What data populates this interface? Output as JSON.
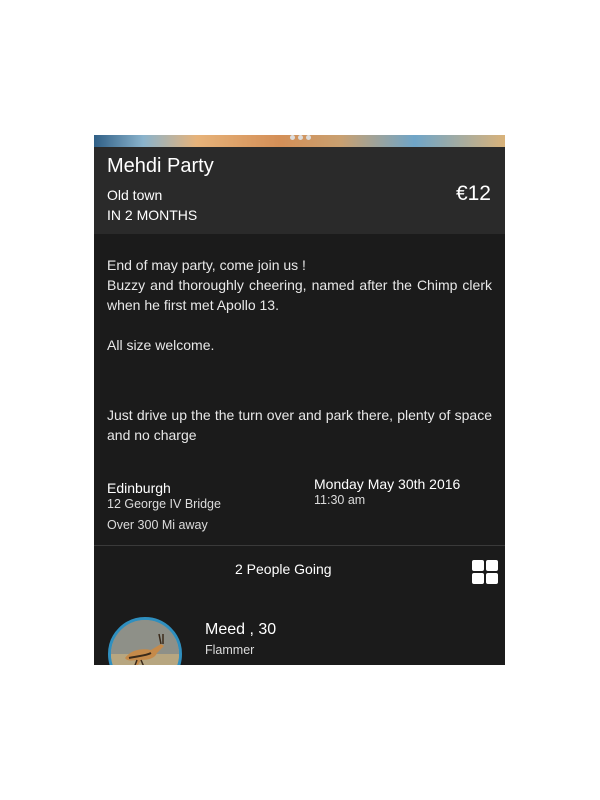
{
  "event": {
    "title": "Mehdi Party",
    "location": "Old town",
    "relative_time": "IN 2 MONTHS",
    "price": "€12",
    "description": {
      "line1": "End of may party, come join us !",
      "line2": "Buzzy and thoroughly cheering, named after the Chimp clerk when he first met Apollo 13.",
      "line3": "All size welcome.",
      "line4": "Just drive up the the turn over and park there, plenty of space and no charge"
    },
    "venue": {
      "city": "Edinburgh",
      "address": "12 George IV Bridge",
      "distance": "Over 300 Mi away"
    },
    "date": "Monday May 30th 2016",
    "time": "11:30 am"
  },
  "attendance": {
    "count_label": "2 People Going",
    "view_toggle_icon": "grid-view-icon"
  },
  "attendees": [
    {
      "name": "Meed , 30",
      "role": "Flammer",
      "avatar_color": "#2f8fbf"
    }
  ],
  "colors": {
    "card_bg": "#1b1b1b",
    "header_bg": "#2a2a2a",
    "avatar_ring": "#2f8fbf"
  }
}
